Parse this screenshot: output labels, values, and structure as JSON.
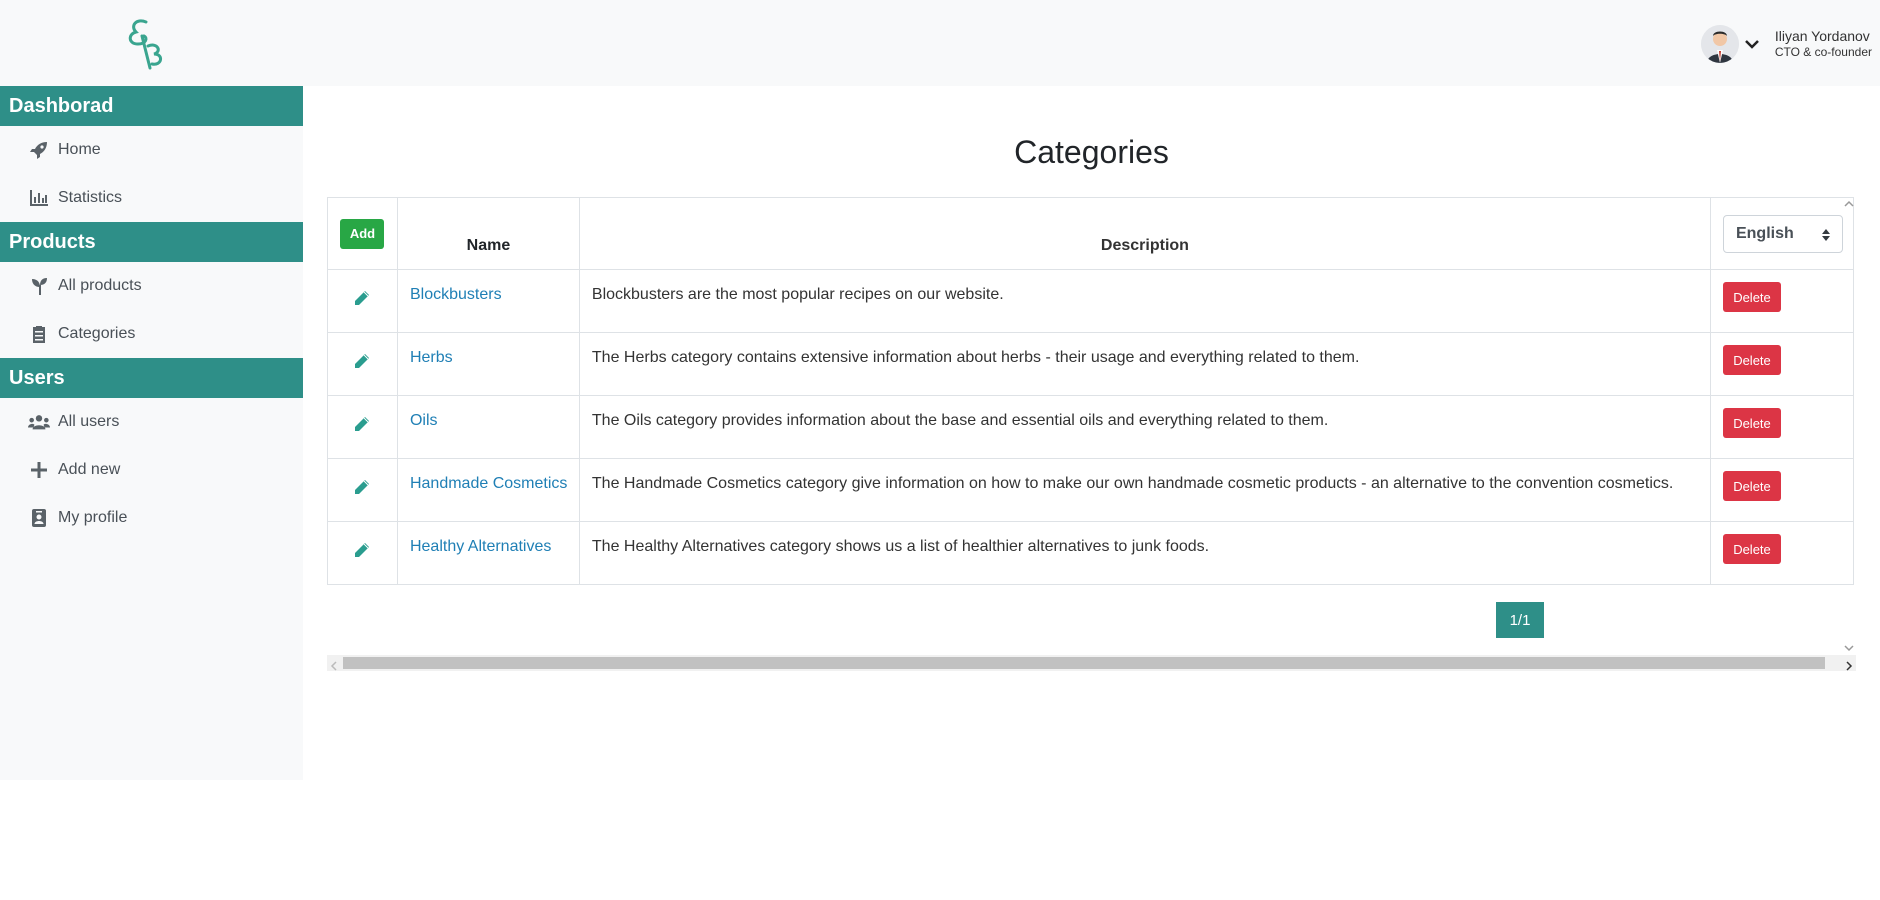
{
  "header": {
    "user_name": "Iliyan Yordanov",
    "user_role": "CTO & co-founder"
  },
  "sidebar": {
    "sections": [
      {
        "title": "Dashborad",
        "items": [
          {
            "label": "Home",
            "icon": "rocket-icon"
          },
          {
            "label": "Statistics",
            "icon": "chart-icon"
          }
        ]
      },
      {
        "title": "Products",
        "items": [
          {
            "label": "All products",
            "icon": "seedling-icon"
          },
          {
            "label": "Categories",
            "icon": "clipboard-icon"
          }
        ]
      },
      {
        "title": "Users",
        "items": [
          {
            "label": "All users",
            "icon": "users-icon"
          },
          {
            "label": "Add new",
            "icon": "plus-icon"
          },
          {
            "label": "My profile",
            "icon": "id-badge-icon"
          }
        ]
      }
    ]
  },
  "main": {
    "title": "Categories",
    "add_label": "Add",
    "columns": {
      "name": "Name",
      "description": "Description"
    },
    "language": "English",
    "delete_label": "Delete",
    "rows": [
      {
        "name": "Blockbusters",
        "description": "Blockbusters are the most popular recipes on our website."
      },
      {
        "name": "Herbs",
        "description": "The Herbs category contains extensive information about herbs - their usage and everything related to them."
      },
      {
        "name": "Oils",
        "description": "The Oils category provides information about the base and essential oils and everything related to them."
      },
      {
        "name": "Handmade Cosmetics",
        "description": "The Handmade Cosmetics category give information on how to make our own handmade cosmetic products - an alternative to the convention cosmetics."
      },
      {
        "name": "Healthy Alternatives",
        "description": "The Healthy Alternatives category shows us a list of healthier alternatives to junk foods."
      }
    ],
    "pagination": "1/1"
  },
  "colors": {
    "accent": "#2e8f88",
    "add": "#28a745",
    "delete": "#dc3545",
    "link": "#1f7fb5"
  }
}
